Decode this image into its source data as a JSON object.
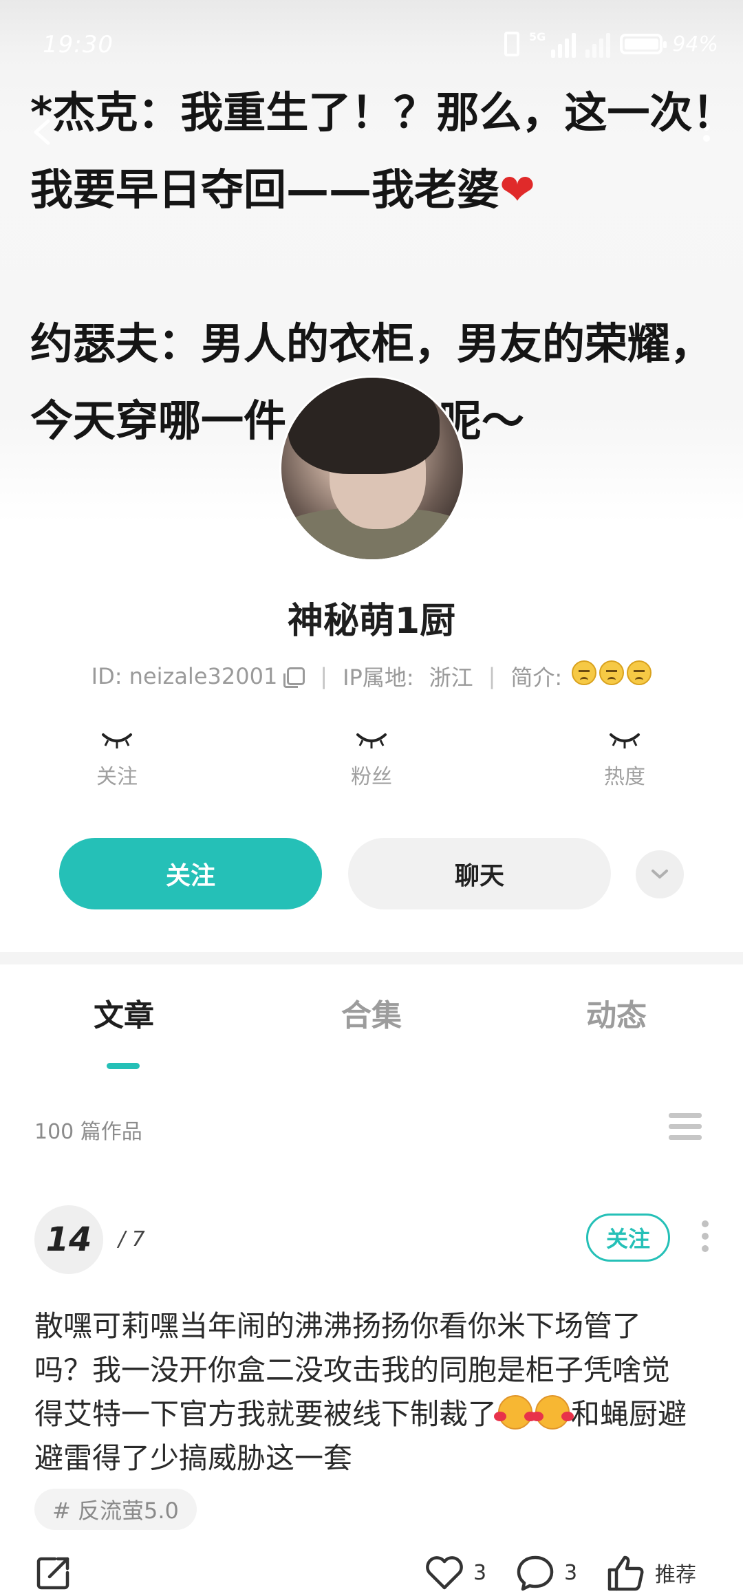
{
  "status_bar": {
    "time": "19:30",
    "network": "5G",
    "battery": "94%"
  },
  "cover": {
    "lines": [
      "*杰克：我重生了！？那么，这一次！",
      "我要早日夺回——我老婆",
      "约瑟夫：男人的衣柜，男友的荣耀，",
      "今天穿哪一件",
      "呢～"
    ],
    "heart": "❤"
  },
  "profile": {
    "nickname": "神秘萌1厨",
    "id_text": "ID: neizale32001",
    "ip_label": "IP属地:",
    "ip_value": "浙江",
    "bio_label": "简介:",
    "divider": "|"
  },
  "stats": {
    "following_label": "关注",
    "fans_label": "粉丝",
    "heat_label": "热度"
  },
  "buttons": {
    "follow": "关注",
    "chat": "聊天"
  },
  "tabs": [
    {
      "label": "文章",
      "active": true
    },
    {
      "label": "合集",
      "active": false
    },
    {
      "label": "动态",
      "active": false
    }
  ],
  "works": {
    "count_text": "100 篇作品"
  },
  "post": {
    "day": "14",
    "month": "/ 7",
    "follow_label": "关注",
    "body": {
      "line1": "散嘿可莉嘿当年闹的沸沸扬扬你看你米下场管了",
      "line2": "吗？我一没开你盒二没攻击我的同胞是柜子凭啥觉",
      "line3_a": "得艾特一下官方我就要被线下制裁了",
      "line3_b": "和蝇厨避",
      "line4": "避雷得了少搞威胁这一套"
    },
    "tag": "# 反流萤5.0",
    "likes": "3",
    "comments": "3",
    "recommend_label": "推荐"
  },
  "colors": {
    "accent": "#25c0b7",
    "text": "#1e1e1e",
    "muted": "#9a9a9a"
  }
}
